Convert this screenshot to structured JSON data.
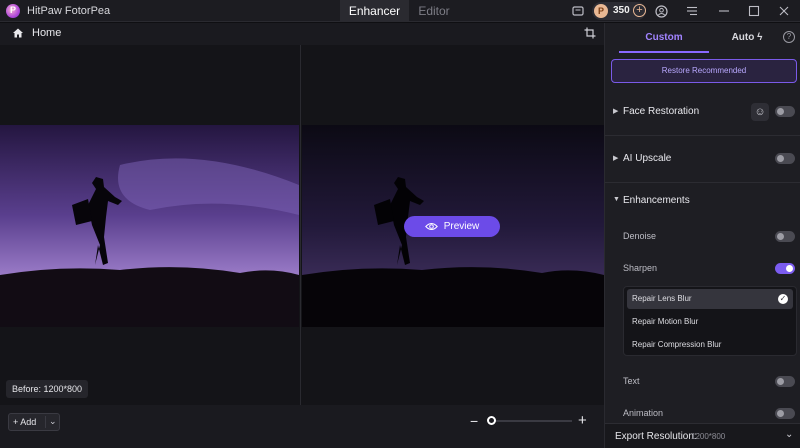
{
  "window": {
    "app_title": "HitPaw FotorPea",
    "logo_letter": "P"
  },
  "mode_tabs": [
    {
      "label": "Enhancer",
      "active": true
    },
    {
      "label": "Editor",
      "active": false
    }
  ],
  "titlebar": {
    "credits": "350",
    "icons": [
      "message-icon",
      "coin-icon",
      "add-credits-icon",
      "account-icon",
      "menu-icon",
      "minimize-icon",
      "maximize-icon",
      "close-icon"
    ]
  },
  "toolbar": {
    "home_label": "Home"
  },
  "canvas": {
    "preview_label": "Preview",
    "before_label": "Before: 1200*800"
  },
  "bottom": {
    "add_label": "Add"
  },
  "panel": {
    "tabs": [
      {
        "label": "Custom",
        "active": true
      },
      {
        "label": "Auto",
        "active": false
      }
    ],
    "restore_label": "Restore Recommended",
    "sections": {
      "face_restoration": {
        "label": "Face Restoration",
        "enabled": false
      },
      "ai_upscale": {
        "label": "AI Upscale",
        "enabled": false
      },
      "enhancements": {
        "label": "Enhancements",
        "expanded": true
      }
    },
    "items": {
      "denoise": {
        "label": "Denoise",
        "enabled": false
      },
      "sharpen": {
        "label": "Sharpen",
        "enabled": true
      },
      "text": {
        "label": "Text",
        "enabled": false
      },
      "animation": {
        "label": "Animation",
        "enabled": false
      }
    },
    "sharpen_options": [
      {
        "label": "Repair Lens Blur",
        "selected": true
      },
      {
        "label": "Repair Motion Blur",
        "selected": false
      },
      {
        "label": "Repair Compression Blur",
        "selected": false
      }
    ],
    "export": {
      "label": "Export Resolution:",
      "value": "1200*800"
    }
  },
  "colors": {
    "accent": "#7b5cf0",
    "accent_text": "#a183ff",
    "background": "#141418"
  }
}
